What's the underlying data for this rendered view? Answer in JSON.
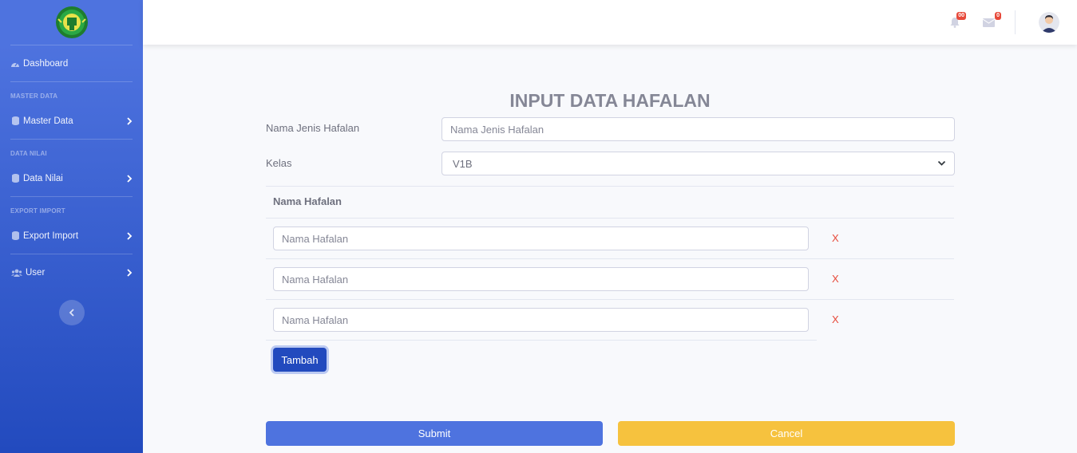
{
  "sidebar": {
    "items": {
      "dashboard": "Dashboard",
      "master_data": "Master Data",
      "data_nilai": "Data Nilai",
      "export_import": "Export Import",
      "user": "User"
    },
    "headings": {
      "master_data": "MASTER DATA",
      "data_nilai": "DATA NILAI",
      "export_import": "EXPORT IMPORT"
    }
  },
  "topbar": {
    "alerts_badge": "00",
    "messages_badge": "0"
  },
  "form": {
    "title": "INPUT DATA HAFALAN",
    "jenis_label": "Nama Jenis Hafalan",
    "jenis_placeholder": "Nama Jenis Hafalan",
    "kelas_label": "Kelas",
    "kelas_value": "V1B",
    "table_header": "Nama Hafalan",
    "rows": [
      {
        "placeholder": "Nama Hafalan",
        "remove": "X"
      },
      {
        "placeholder": "Nama Hafalan",
        "remove": "X"
      },
      {
        "placeholder": "Nama Hafalan",
        "remove": "X"
      }
    ],
    "add_label": "Tambah",
    "submit_label": "Submit",
    "cancel_label": "Cancel"
  },
  "colors": {
    "primary": "#4e73df",
    "primary_dark": "#224abe",
    "warning": "#f6c23e",
    "danger": "#e74a3b",
    "text_muted": "#858796"
  }
}
